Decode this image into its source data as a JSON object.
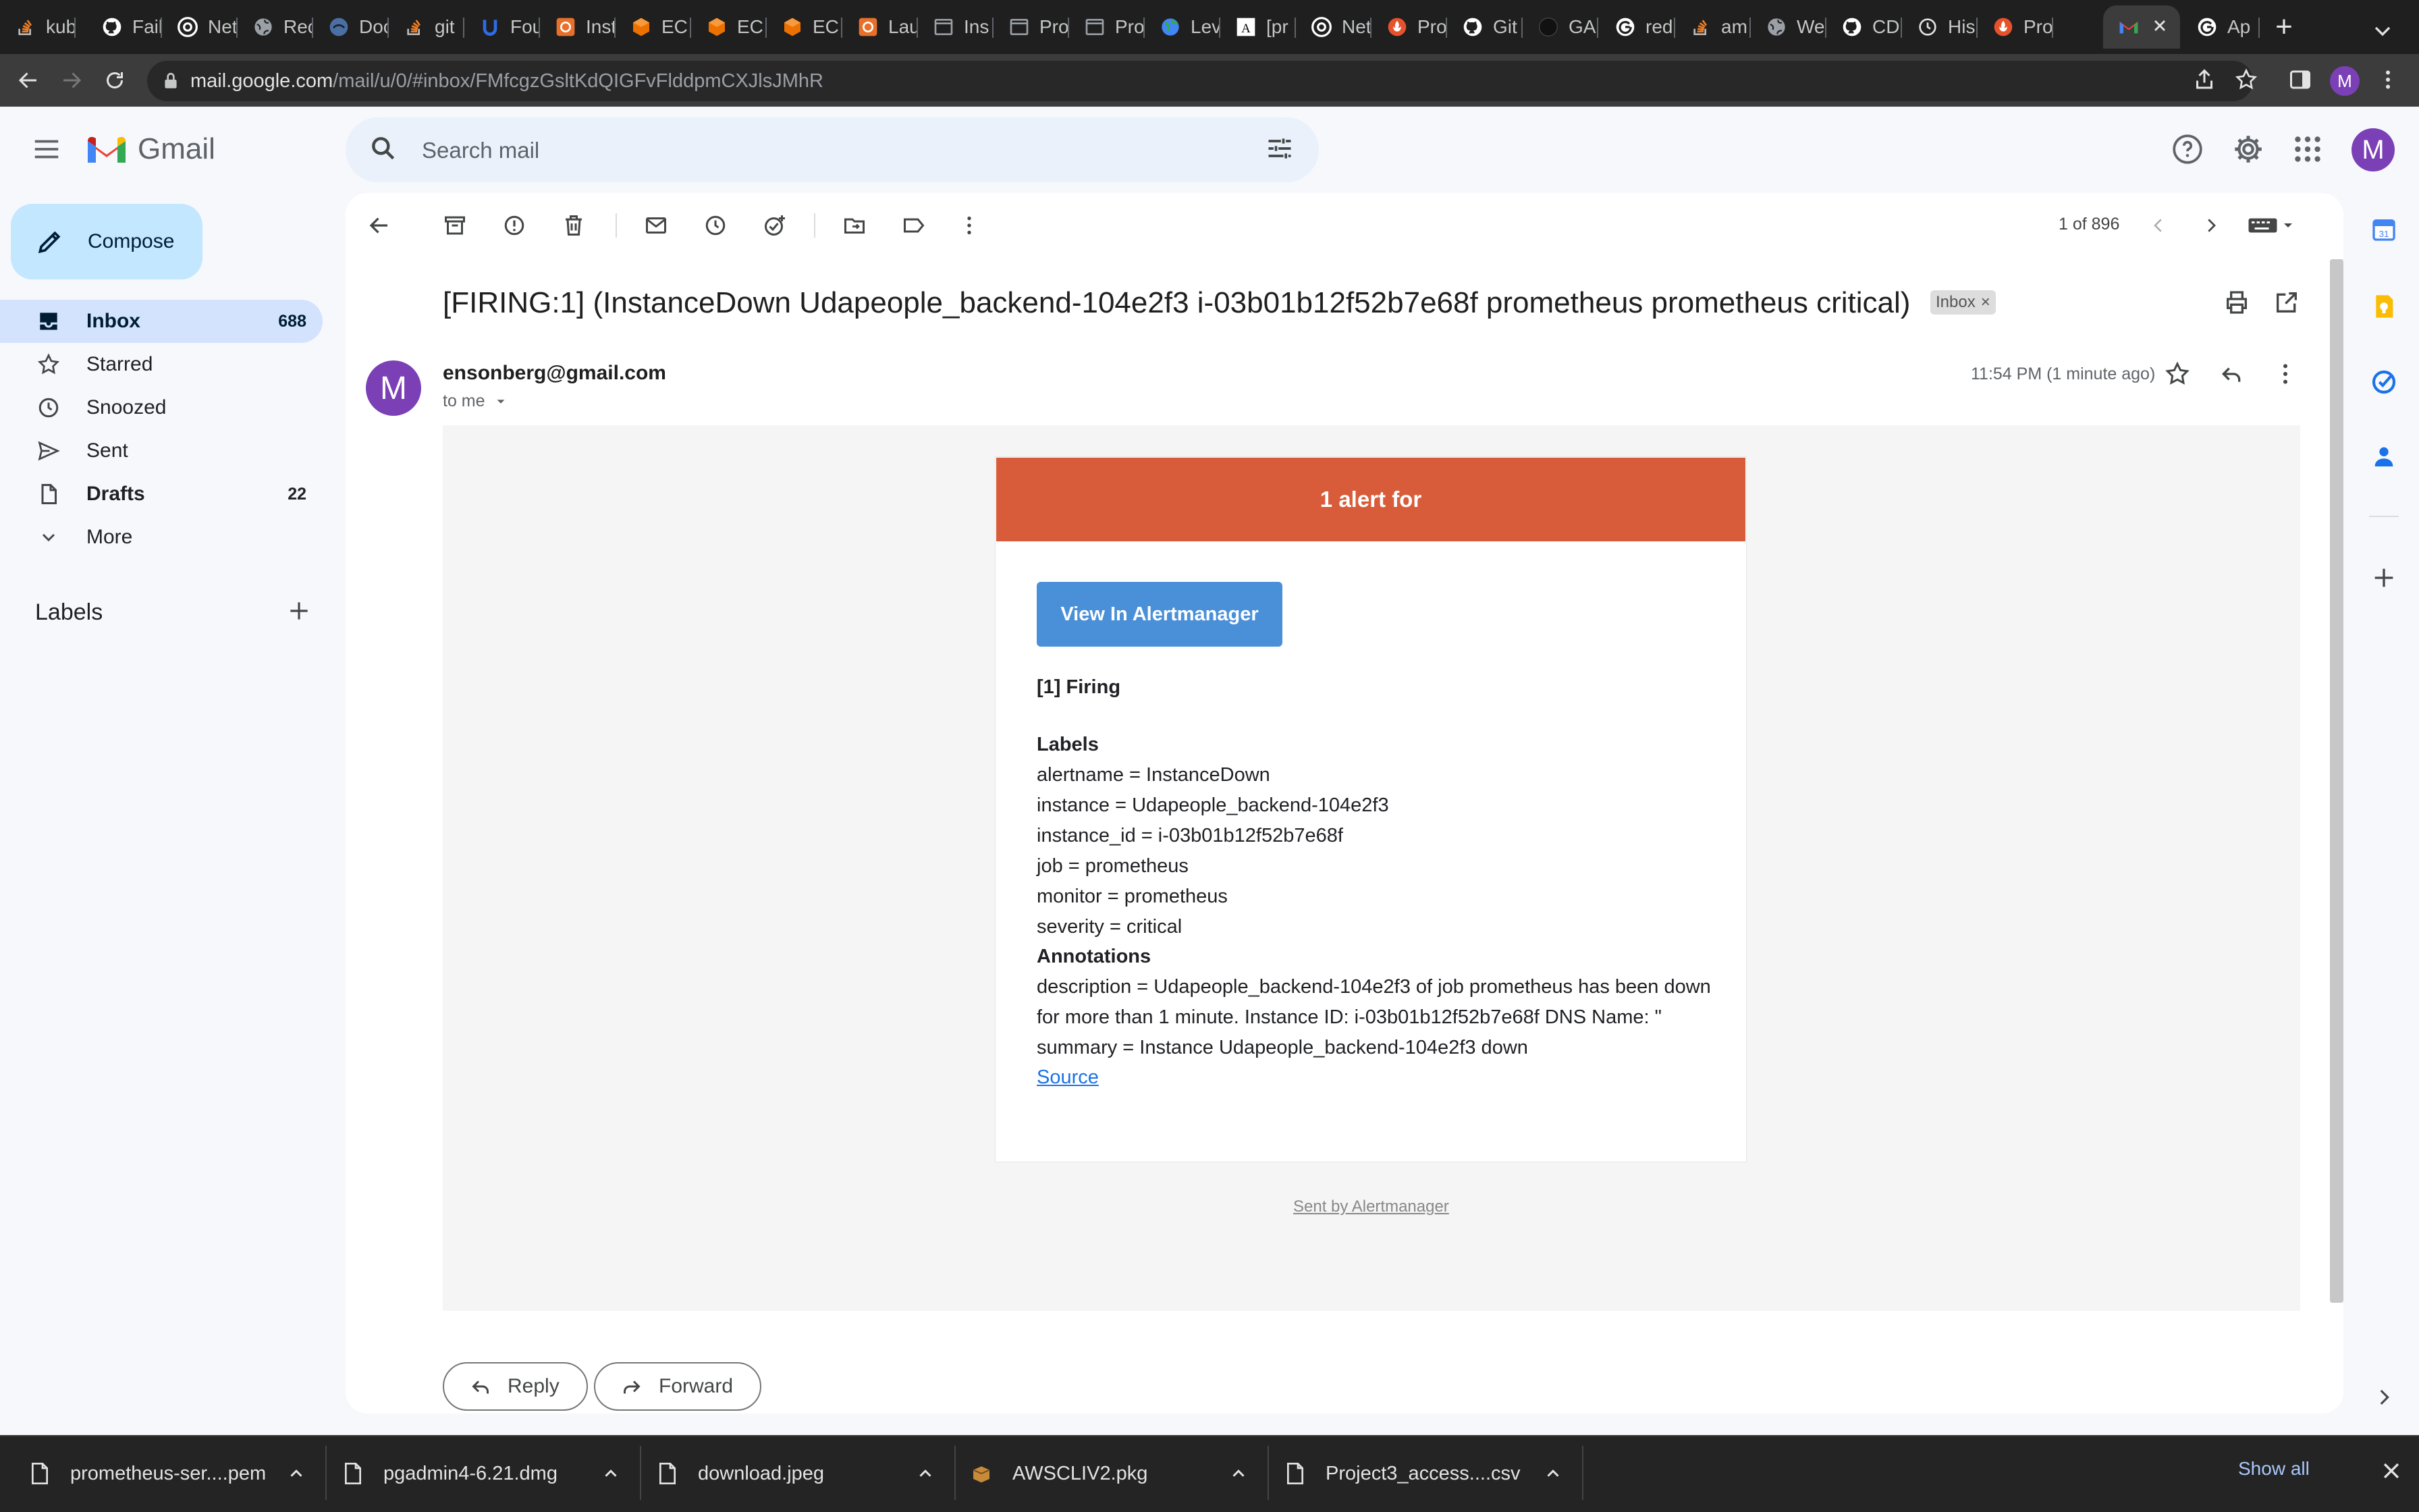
{
  "browser": {
    "tabs": [
      {
        "label": "kub",
        "icon": "stackoverflow-icon",
        "color": "#f48024"
      },
      {
        "label": "Fail",
        "icon": "github-icon",
        "color": "#ffffff"
      },
      {
        "label": "Net",
        "icon": "chrome-icon",
        "color": "#ffffff"
      },
      {
        "label": "Rec",
        "icon": "globe-icon",
        "color": "#9aa0a6"
      },
      {
        "label": "Doc",
        "icon": "docs-icon",
        "color": "#4a6fa5"
      },
      {
        "label": "git",
        "icon": "stackoverflow-icon",
        "color": "#f48024"
      },
      {
        "label": "Fou",
        "icon": "udacity-icon",
        "color": "#2e6ce6"
      },
      {
        "label": "Inst",
        "icon": "aws-icon",
        "color": "#e8702a"
      },
      {
        "label": "EC",
        "icon": "ec2-icon",
        "color": "#ed7100"
      },
      {
        "label": "EC",
        "icon": "ec2-icon",
        "color": "#ed7100"
      },
      {
        "label": "EC",
        "icon": "ec2-icon",
        "color": "#ed7100"
      },
      {
        "label": "Lau",
        "icon": "aws-icon",
        "color": "#e8702a"
      },
      {
        "label": "Ins",
        "icon": "page-icon",
        "color": "#9aa0a6"
      },
      {
        "label": "Pro",
        "icon": "page-icon",
        "color": "#9aa0a6"
      },
      {
        "label": "Pro",
        "icon": "page-icon",
        "color": "#9aa0a6"
      },
      {
        "label": "Lev",
        "icon": "globe-color-icon",
        "color": "#34a853"
      },
      {
        "label": "[pr",
        "icon": "wiki-icon",
        "color": "#ffffff"
      },
      {
        "label": "Net",
        "icon": "chrome-icon",
        "color": "#ffffff"
      },
      {
        "label": "Pro",
        "icon": "prometheus-icon",
        "color": "#e6522c"
      },
      {
        "label": "Git",
        "icon": "github-icon",
        "color": "#ffffff"
      },
      {
        "label": "GA",
        "icon": "circle-icon",
        "color": "#111111"
      },
      {
        "label": "red",
        "icon": "google-icon",
        "color": "#ffffff"
      },
      {
        "label": "am",
        "icon": "stackoverflow-icon",
        "color": "#f48024"
      },
      {
        "label": "We",
        "icon": "globe-icon",
        "color": "#9aa0a6"
      },
      {
        "label": "CD",
        "icon": "github-icon",
        "color": "#ffffff"
      },
      {
        "label": "His",
        "icon": "history-icon",
        "color": "#e3e3e3"
      },
      {
        "label": "Pro",
        "icon": "prometheus-icon",
        "color": "#e6522c"
      },
      {
        "label": "",
        "icon": "gmail-icon",
        "color": "#ea4335",
        "active": true
      },
      {
        "label": "Ap",
        "icon": "google-icon",
        "color": "#ffffff"
      }
    ],
    "url_host": "mail.google.com",
    "url_path": "/mail/u/0/#inbox/FMfcgzGsltKdQIGFvFlddpmCXJlsJMhR"
  },
  "gmail": {
    "brand": "Gmail",
    "search_placeholder": "Search mail",
    "compose_label": "Compose",
    "nav": [
      {
        "label": "Inbox",
        "count": "688",
        "icon": "inbox-icon",
        "active": true
      },
      {
        "label": "Starred",
        "count": "",
        "icon": "star-icon"
      },
      {
        "label": "Snoozed",
        "count": "",
        "icon": "clock-icon"
      },
      {
        "label": "Sent",
        "count": "",
        "icon": "send-icon"
      },
      {
        "label": "Drafts",
        "count": "22",
        "icon": "draft-icon",
        "bold": true
      },
      {
        "label": "More",
        "count": "",
        "icon": "chevron-down-icon"
      }
    ],
    "labels_heading": "Labels",
    "pager": "1 of 896"
  },
  "email": {
    "subject": "[FIRING:1] (InstanceDown Udapeople_backend-104e2f3 i-03b01b12f52b7e68f prometheus prometheus critical)",
    "tag": "Inbox",
    "avatar_letter": "M",
    "sender": "ensonberg@gmail.com",
    "to": "to me",
    "time": "11:54 PM (1 minute ago)",
    "body": {
      "header": "1 alert for",
      "button": "View In Alertmanager",
      "firing": "[1] Firing",
      "labels_heading": "Labels",
      "labels": [
        "alertname = InstanceDown",
        "instance = Udapeople_backend-104e2f3",
        "instance_id = i-03b01b12f52b7e68f",
        "job = prometheus",
        "monitor = prometheus",
        "severity = critical"
      ],
      "annotations_heading": "Annotations",
      "annotation_lines": [
        "description = Udapeople_backend-104e2f3 of job prometheus has been down",
        "for more than 1 minute. Instance ID: i-03b01b12f52b7e68f DNS Name: \"",
        "summary = Instance Udapeople_backend-104e2f3 down"
      ],
      "source": "Source",
      "footer": "Sent by Alertmanager"
    },
    "reply_label": "Reply",
    "forward_label": "Forward"
  },
  "downloads": {
    "items": [
      {
        "name": "prometheus-ser....pem"
      },
      {
        "name": "pgadmin4-6.21.dmg"
      },
      {
        "name": "download.jpeg"
      },
      {
        "name": "AWSCLIV2.pkg"
      },
      {
        "name": "Project3_access....csv"
      }
    ],
    "show_all": "Show all"
  },
  "colors": {
    "alert_header": "#d85c3a",
    "alert_button": "#4a90d9",
    "avatar": "#7b3fb6",
    "inbox_active": "#d3e3fd",
    "compose": "#c2e7ff"
  }
}
